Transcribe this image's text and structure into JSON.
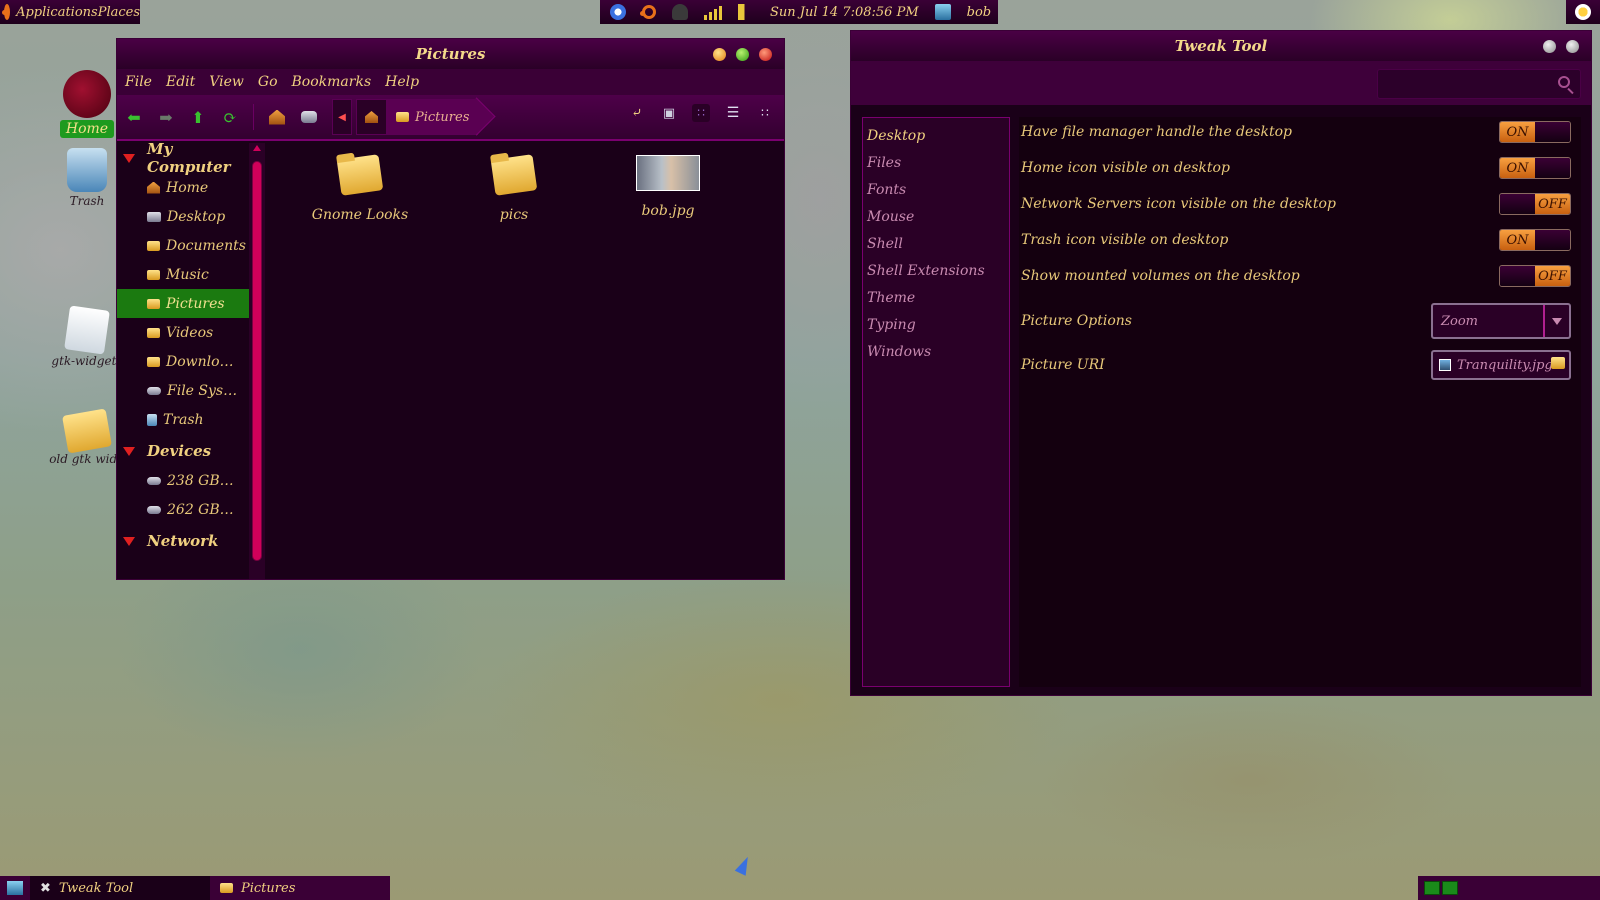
{
  "top_panel": {
    "menu_label": "ApplicationsPlaces",
    "clock": "Sun Jul 14   7:08:56 PM",
    "user": "bob"
  },
  "desktop_icons": [
    {
      "label": "Home"
    },
    {
      "label": "Trash"
    },
    {
      "label": "gtk-widgets"
    },
    {
      "label": "old gtk widg"
    }
  ],
  "file_manager": {
    "title": "Pictures",
    "menu": [
      "File",
      "Edit",
      "View",
      "Go",
      "Bookmarks",
      "Help"
    ],
    "breadcrumb": "Pictures",
    "sidebar": {
      "sections": [
        {
          "heading": "My Computer",
          "items": [
            "Home",
            "Desktop",
            "Documents",
            "Music",
            "Pictures",
            "Videos",
            "Downlo…",
            "File Sys…",
            "Trash"
          ]
        },
        {
          "heading": "Devices",
          "items": [
            "238 GB…",
            "262 GB…"
          ]
        },
        {
          "heading": "Network",
          "items": []
        }
      ],
      "selected": "Pictures"
    },
    "files": [
      {
        "name": "Gnome Looks",
        "type": "folder"
      },
      {
        "name": "pics",
        "type": "folder"
      },
      {
        "name": "bob.jpg",
        "type": "image"
      }
    ]
  },
  "tweak_tool": {
    "title": "Tweak Tool",
    "search_placeholder": "",
    "nav": [
      "Desktop",
      "Files",
      "Fonts",
      "Mouse",
      "Shell",
      "Shell Extensions",
      "Theme",
      "Typing",
      "Windows"
    ],
    "selected_nav": "Desktop",
    "settings": [
      {
        "label": "Have file manager handle the desktop",
        "state": "ON"
      },
      {
        "label": "Home icon visible on desktop",
        "state": "ON"
      },
      {
        "label": "Network Servers icon visible on the desktop",
        "state": "OFF"
      },
      {
        "label": "Trash icon visible on desktop",
        "state": "ON"
      },
      {
        "label": "Show mounted volumes on the desktop",
        "state": "OFF"
      }
    ],
    "picture_options": {
      "label": "Picture Options",
      "value": "Zoom"
    },
    "picture_uri": {
      "label": "Picture URI",
      "value": "Tranquility.jpg"
    }
  },
  "bottom_panel": {
    "tasks": [
      "Tweak Tool",
      "Pictures"
    ]
  },
  "colors": {
    "accent": "#4a0045",
    "text": "#e8c87a",
    "selection": "#1b7a10",
    "switch_on": "#f8a040"
  }
}
